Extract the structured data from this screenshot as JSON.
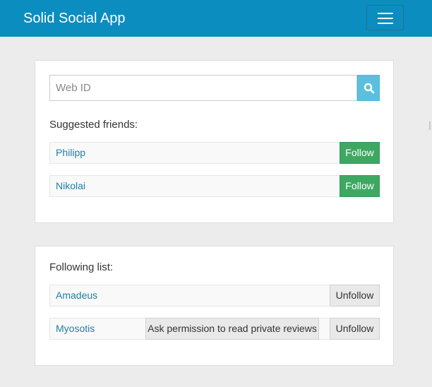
{
  "navbar": {
    "brand": "Solid Social App",
    "menu_icon": "hamburger-menu-icon",
    "color": "#0b8dbf"
  },
  "search": {
    "placeholder": "Web ID",
    "value": "",
    "button_icon": "search-icon"
  },
  "suggested": {
    "label": "Suggested friends:",
    "items": [
      {
        "name": "Philipp",
        "action": "Follow"
      },
      {
        "name": "Nikolai",
        "action": "Follow"
      }
    ]
  },
  "following": {
    "label": "Following list:",
    "items": [
      {
        "name": "Amadeus",
        "action": "Unfollow"
      },
      {
        "name": "Myosotis",
        "extra_action": "Ask permission to read private reviews",
        "action": "Unfollow"
      }
    ]
  },
  "colors": {
    "accent": "#0b8dbf",
    "follow": "#3ea863",
    "search_button": "#5bc0de",
    "link": "#1f7fa8"
  }
}
